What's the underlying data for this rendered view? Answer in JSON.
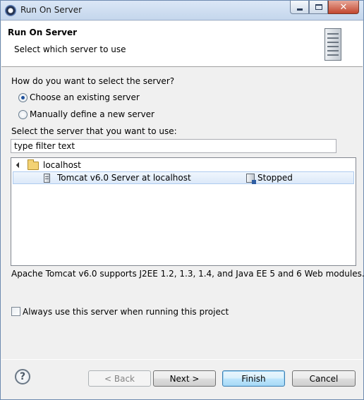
{
  "window": {
    "title": "Run On Server"
  },
  "header": {
    "title": "Run On Server",
    "description": "Select which server to use"
  },
  "selection": {
    "question": "How do you want to select the server?",
    "options": [
      {
        "label": "Choose an existing server",
        "selected": true
      },
      {
        "label": "Manually define a new server",
        "selected": false
      }
    ]
  },
  "server_list": {
    "label": "Select the server that you want to use:",
    "filter_value": "type filter text",
    "tree": {
      "host": "localhost",
      "servers": [
        {
          "name": "Tomcat v6.0 Server at localhost",
          "state": "Stopped",
          "selected": true
        }
      ]
    },
    "description": "Apache Tomcat v6.0 supports J2EE 1.2, 1.3, 1.4, and Java EE 5 and 6 Web modules."
  },
  "always_use": {
    "label": "Always use this server when running this project",
    "checked": false
  },
  "buttons": {
    "back": "< Back",
    "next": "Next >",
    "finish": "Finish",
    "cancel": "Cancel",
    "help_icon": "?"
  },
  "icons": [
    "eclipse-app-icon",
    "server-wizard-icon",
    "folder-icon",
    "tomcat-server-icon",
    "server-status-icon",
    "help-icon"
  ]
}
